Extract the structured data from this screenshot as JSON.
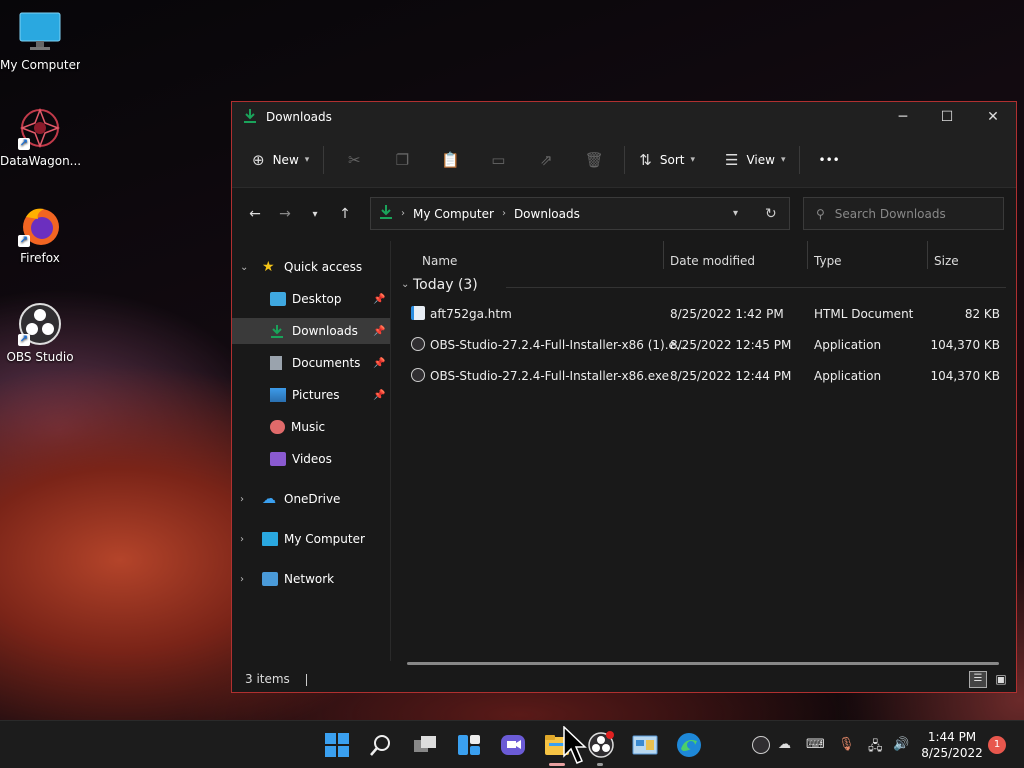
{
  "desktop": {
    "icons": [
      {
        "label": "My Computer"
      },
      {
        "label": "DataWagon..."
      },
      {
        "label": "Firefox"
      },
      {
        "label": "OBS Studio"
      }
    ]
  },
  "window": {
    "title": "Downloads",
    "controls": {
      "minimize": "─",
      "maximize": "☐",
      "close": "✕"
    }
  },
  "toolbar": {
    "new_label": "New",
    "sort_label": "Sort",
    "view_label": "View",
    "more_label": "•••"
  },
  "address": {
    "crumbs": [
      "My Computer",
      "Downloads"
    ]
  },
  "search": {
    "placeholder": "Search Downloads"
  },
  "navpane": {
    "quick_access": "Quick access",
    "items": [
      {
        "label": "Desktop",
        "pinned": true
      },
      {
        "label": "Downloads",
        "pinned": true,
        "selected": true
      },
      {
        "label": "Documents",
        "pinned": true
      },
      {
        "label": "Pictures",
        "pinned": true
      },
      {
        "label": "Music",
        "pinned": false
      },
      {
        "label": "Videos",
        "pinned": false
      }
    ],
    "onedrive": "OneDrive",
    "my_computer": "My Computer",
    "network": "Network"
  },
  "columns": {
    "name": "Name",
    "date": "Date modified",
    "type": "Type",
    "size": "Size"
  },
  "group": {
    "label": "Today (3)"
  },
  "files": [
    {
      "name": "aft752ga.htm",
      "date": "8/25/2022 1:42 PM",
      "type": "HTML Document",
      "size": "82 KB"
    },
    {
      "name": "OBS-Studio-27.2.4-Full-Installer-x86 (1).e...",
      "date": "8/25/2022 12:45 PM",
      "type": "Application",
      "size": "104,370 KB"
    },
    {
      "name": "OBS-Studio-27.2.4-Full-Installer-x86.exe",
      "date": "8/25/2022 12:44 PM",
      "type": "Application",
      "size": "104,370 KB"
    }
  ],
  "status": {
    "items_count": "3 items"
  },
  "taskbar": {
    "time": "1:44 PM",
    "date": "8/25/2022",
    "notification_count": "1"
  },
  "colors": {
    "accent": "#1aa35a",
    "window_border": "#b03030",
    "selection": "#3a3a3a"
  }
}
